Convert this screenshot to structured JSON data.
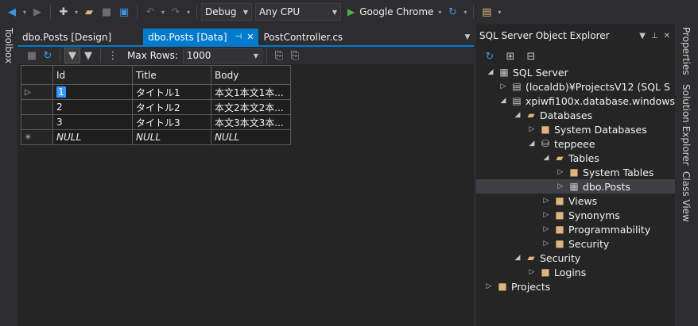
{
  "toolbar": {
    "config": "Debug",
    "platform": "Any CPU",
    "run_target": "Google Chrome"
  },
  "left_strip": {
    "toolbox": "Toolbox"
  },
  "doc_tabs": [
    {
      "label": "dbo.Posts [Design]"
    },
    {
      "label": "dbo.Posts [Data]"
    },
    {
      "label": "PostController.cs"
    }
  ],
  "data_toolbar": {
    "max_rows_label": "Max Rows:",
    "max_rows_value": "1000"
  },
  "grid": {
    "columns": [
      "Id",
      "Title",
      "Body"
    ],
    "rows": [
      {
        "id": "1",
        "title": "タイトル1",
        "body": "本文1本文1本..."
      },
      {
        "id": "2",
        "title": "タイトル2",
        "body": "本文2本文2本..."
      },
      {
        "id": "3",
        "title": "タイトル3",
        "body": "本文3本文3本..."
      },
      {
        "id": "NULL",
        "title": "NULL",
        "body": "NULL"
      }
    ]
  },
  "explorer": {
    "title": "SQL Server Object Explorer",
    "tree": {
      "sql_server": "SQL Server",
      "localdb": "(localdb)¥ProjectsV12 (SQL S",
      "azure": "xpiwfi100x.database.windows",
      "databases": "Databases",
      "system_databases": "System Databases",
      "teppeee": "teppeee",
      "tables": "Tables",
      "system_tables": "System Tables",
      "dbo_posts": "dbo.Posts",
      "views": "Views",
      "synonyms": "Synonyms",
      "programmability": "Programmability",
      "security_db": "Security",
      "security_srv": "Security",
      "logins": "Logins",
      "projects": "Projects"
    }
  },
  "right_strip": {
    "properties": "Properties",
    "solution_explorer": "Solution Explorer",
    "class_view": "Class View"
  },
  "colors": {
    "background": "#2d2d30",
    "accent": "#007acc",
    "folder": "#dcb67a",
    "run_green": "#48b34b",
    "selection": "#3399ff"
  }
}
